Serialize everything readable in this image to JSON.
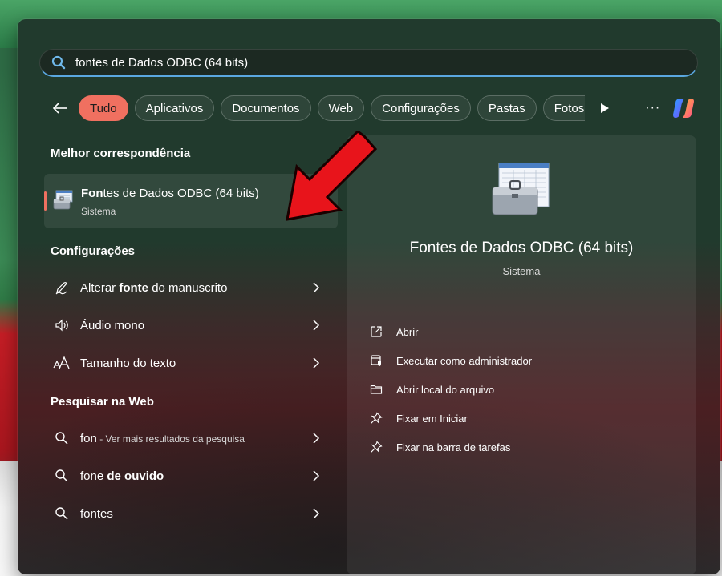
{
  "search": {
    "value": "fontes de Dados ODBC (64 bits)"
  },
  "filters": {
    "chips": [
      "Tudo",
      "Aplicativos",
      "Documentos",
      "Web",
      "Configurações",
      "Pastas",
      "Fotos"
    ],
    "more_label": "···"
  },
  "best_match": {
    "section_title": "Melhor correspondência",
    "title_bold": "Fon",
    "title_rest": "tes de Dados ODBC (64 bits)",
    "subtitle": "Sistema"
  },
  "settings": {
    "section_title": "Configurações",
    "items": [
      {
        "pre": "Alterar ",
        "bold": "fonte",
        "post": " do manuscrito",
        "icon": "pen-icon"
      },
      {
        "pre": "Áudio mono",
        "bold": "",
        "post": "",
        "icon": "speaker-icon"
      },
      {
        "pre": "Tamanho do texto",
        "bold": "",
        "post": "",
        "icon": "text-size-icon"
      }
    ]
  },
  "web": {
    "section_title": "Pesquisar na Web",
    "items": [
      {
        "bold": "fon",
        "hint": " - Ver mais resultados da pesquisa",
        "post": ""
      },
      {
        "bold": "",
        "pre": "fone ",
        "post": "de ouvido",
        "hint": ""
      },
      {
        "bold": "",
        "pre": "fontes",
        "post": "",
        "hint": ""
      }
    ]
  },
  "preview": {
    "title": "Fontes de Dados ODBC (64 bits)",
    "subtitle": "Sistema",
    "actions": [
      {
        "label": "Abrir",
        "icon": "open-external-icon"
      },
      {
        "label": "Executar como administrador",
        "icon": "admin-shield-icon"
      },
      {
        "label": "Abrir local do arquivo",
        "icon": "folder-icon"
      },
      {
        "label": "Fixar em Iniciar",
        "icon": "pin-icon"
      },
      {
        "label": "Fixar na barra de tarefas",
        "icon": "pin-icon"
      }
    ]
  },
  "colors": {
    "accent": "#f07060",
    "search_underline": "#5aa7e0",
    "arrow_red": "#e8141b"
  }
}
